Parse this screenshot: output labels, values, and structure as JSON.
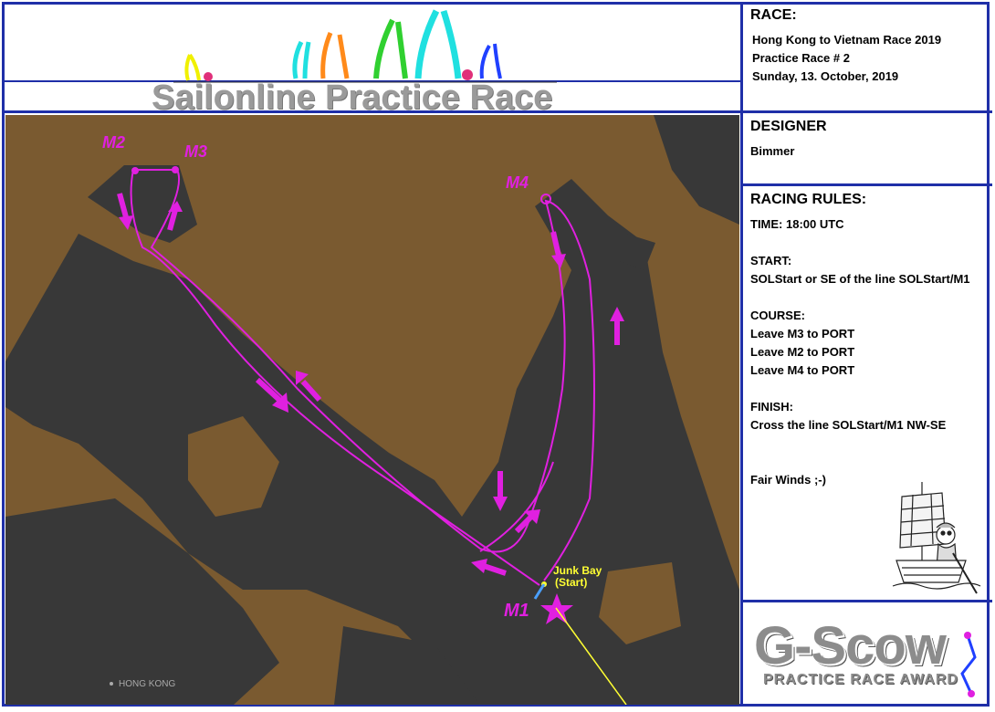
{
  "banner": {
    "title": "Sailonline Practice Race"
  },
  "race": {
    "heading": "RACE:",
    "lines": [
      "Hong Kong to Vietnam Race 2019",
      "Practice Race # 2",
      "Sunday, 13. October, 2019"
    ]
  },
  "designer": {
    "heading": "DESIGNER",
    "name": "Bimmer"
  },
  "rules": {
    "heading": "RACING RULES:",
    "time": "TIME:  18:00 UTC",
    "start_heading": "START:",
    "start_text": "SOLStart or SE of the line SOLStart/M1",
    "course_heading": "COURSE:",
    "course": [
      "Leave M3 to PORT",
      "Leave M2 to PORT",
      "Leave M4 to PORT"
    ],
    "finish_heading": "FINISH:",
    "finish_text": "Cross the line SOLStart/M1 NW-SE",
    "closing": "Fair Winds ;-)"
  },
  "map": {
    "marks": [
      "M2",
      "M3",
      "M4",
      "M1"
    ],
    "start_label_1": "Junk Bay",
    "start_label_2": "(Start)",
    "place_label": "HONG KONG"
  },
  "award": {
    "main": "G-Scow",
    "sub": "PRACTICE RACE AWARD"
  },
  "colors": {
    "border": "#1f2fa8",
    "land": "#7a5a30",
    "water": "#383838",
    "route": "#e020e0",
    "start": "#ffff33"
  }
}
